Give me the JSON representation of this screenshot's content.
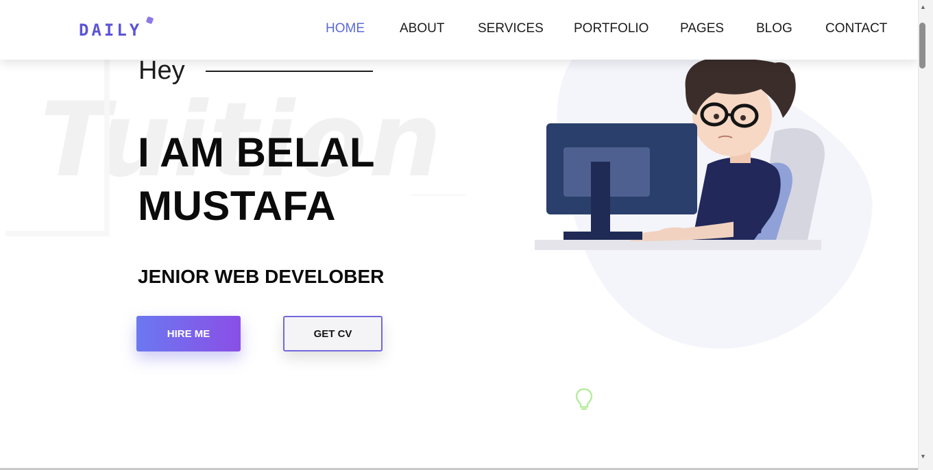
{
  "brand": {
    "logo_text": "DAILY",
    "accent": "#5b54d6"
  },
  "nav": {
    "items": [
      "HOME",
      "ABOUT",
      "SERVICES",
      "PORTFOLIO",
      "PAGES",
      "BLOG",
      "CONTACT"
    ],
    "active": "HOME",
    "active_color": "#5b6ad6"
  },
  "hero": {
    "watermark": "Tuition",
    "greeting": "Hey",
    "name_line1": "I AM BELAL",
    "name_line2": "MUSTAFA",
    "role": "JENIOR WEB DEVELOBER",
    "hire_label": "HIRE ME",
    "cv_label": "GET CV",
    "button_gradient": [
      "#6b78f0",
      "#8a4fe6"
    ]
  },
  "icons": {
    "illustration": "developer-at-computer-illustration",
    "bulb": "lightbulb-icon"
  }
}
